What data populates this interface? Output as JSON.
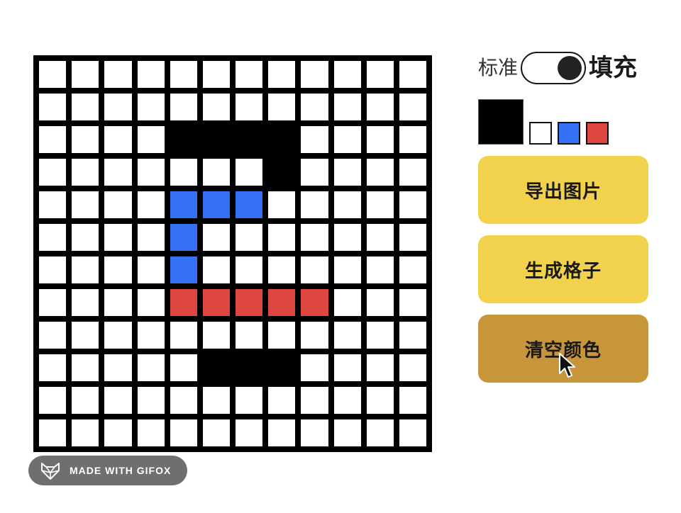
{
  "mode": {
    "left_label": "标准",
    "right_label": "填充",
    "state": "填充"
  },
  "colors": {
    "current": "#000000",
    "palette": [
      "#ffffff",
      "#3571f5",
      "#de4640"
    ],
    "map": {
      "W": "#ffffff",
      "K": "#000000",
      "B": "#3571f5",
      "R": "#de4640"
    }
  },
  "grid": {
    "rows": [
      "WWWWWWWWWWWW",
      "WWWWWWWWWWWW",
      "WWWWKKKKWWWW",
      "WWWWWWWKWWWW",
      "WWWWBBBWWWWW",
      "WWWWBWWWWWWW",
      "WWWWBWWWWWWW",
      "WWWWRRRRRWWW",
      "WWWWWWWWWWWW",
      "WWWWWKKKWWWW",
      "WWWWWWWWWWWW",
      "WWWWWWWWWWWW"
    ]
  },
  "buttons": {
    "export": "导出图片",
    "generate": "生成格子",
    "clear": "清空颜色"
  },
  "watermark": {
    "text": "MADE WITH GIFOX",
    "icon": "fox-icon"
  }
}
